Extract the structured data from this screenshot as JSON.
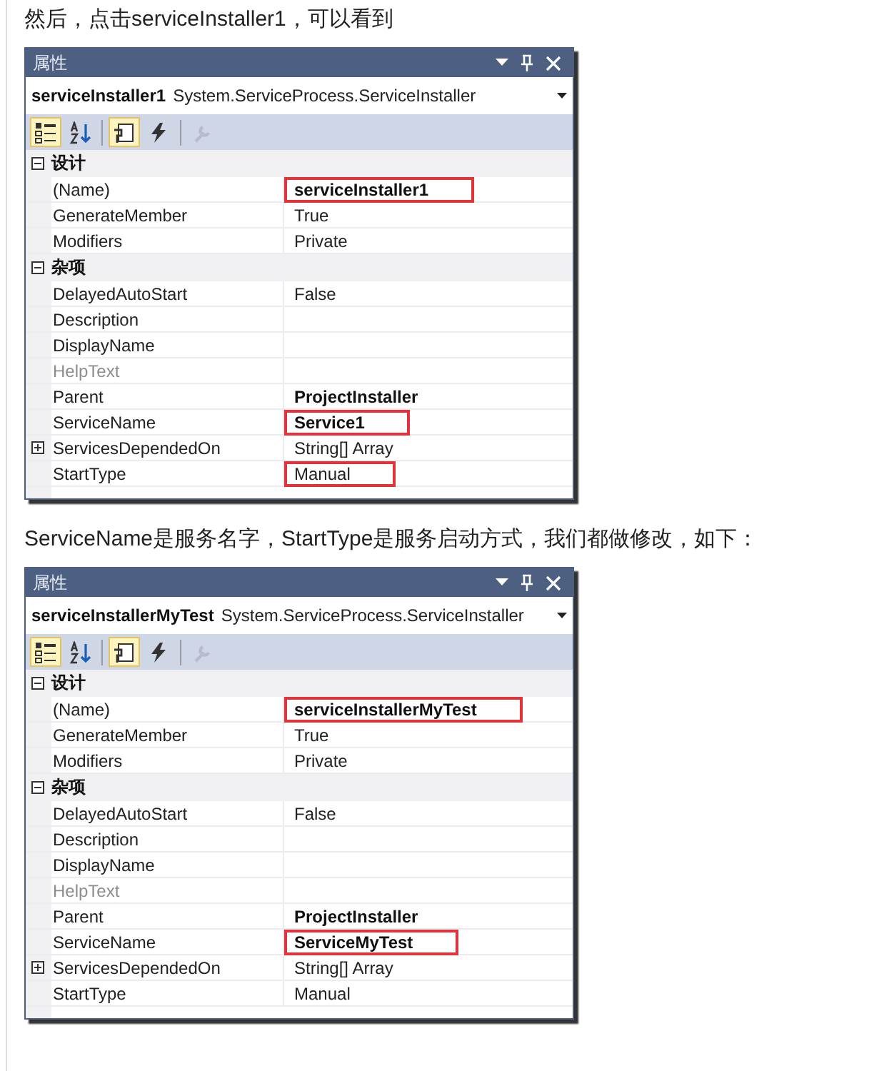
{
  "blocks": [
    {
      "kind": "paragraph",
      "text": "然后，点击serviceInstaller1，可以看到"
    },
    {
      "kind": "panel",
      "title": "属性",
      "object_name": "serviceInstaller1",
      "object_type": "System.ServiceProcess.ServiceInstaller",
      "toolbar": [
        {
          "kind": "categorized",
          "selected": true,
          "disabled": false
        },
        {
          "kind": "alphabetical",
          "selected": false,
          "disabled": false
        },
        {
          "kind": "properties",
          "selected": true,
          "disabled": false
        },
        {
          "kind": "events",
          "selected": false,
          "disabled": false
        },
        {
          "kind": "pages",
          "selected": false,
          "disabled": true
        }
      ],
      "categories": [
        {
          "label": "设计",
          "expanded": true,
          "properties": [
            {
              "name": "(Name)",
              "value": "serviceInstaller1",
              "bold": true,
              "highlighted": true,
              "disabled": false
            },
            {
              "name": "GenerateMember",
              "value": "True",
              "bold": false,
              "highlighted": false,
              "disabled": false
            },
            {
              "name": "Modifiers",
              "value": "Private",
              "bold": false,
              "highlighted": false,
              "disabled": false
            }
          ]
        },
        {
          "label": "杂项",
          "expanded": true,
          "properties": [
            {
              "name": "DelayedAutoStart",
              "value": "False",
              "bold": false,
              "highlighted": false,
              "disabled": false
            },
            {
              "name": "Description",
              "disabled": false
            },
            {
              "name": "DisplayName",
              "disabled": false
            },
            {
              "name": "HelpText",
              "disabled": true
            },
            {
              "name": "Parent",
              "value": "ProjectInstaller",
              "bold": true,
              "highlighted": false,
              "disabled": false
            },
            {
              "name": "ServiceName",
              "value": "Service1",
              "bold": true,
              "highlighted": true,
              "disabled": false
            },
            {
              "name": "ServicesDependedOn",
              "value": "String[] Array",
              "bold": false,
              "highlighted": false,
              "disabled": false,
              "expanded": false
            },
            {
              "name": "StartType",
              "value": "Manual",
              "bold": false,
              "highlighted": true,
              "disabled": false
            }
          ]
        }
      ]
    },
    {
      "kind": "paragraph",
      "text": "ServiceName是服务名字，StartType是服务启动方式，我们都做修改，如下："
    },
    {
      "kind": "panel",
      "title": "属性",
      "object_name": "serviceInstallerMyTest",
      "object_type": "System.ServiceProcess.ServiceInstaller",
      "toolbar": [
        {
          "kind": "categorized",
          "selected": true,
          "disabled": false
        },
        {
          "kind": "alphabetical",
          "selected": false,
          "disabled": false
        },
        {
          "kind": "properties",
          "selected": true,
          "disabled": false
        },
        {
          "kind": "events",
          "selected": false,
          "disabled": false
        },
        {
          "kind": "pages",
          "selected": false,
          "disabled": true
        }
      ],
      "categories": [
        {
          "label": "设计",
          "expanded": true,
          "properties": [
            {
              "name": "(Name)",
              "value": "serviceInstallerMyTest",
              "bold": true,
              "highlighted": true,
              "disabled": false
            },
            {
              "name": "GenerateMember",
              "value": "True",
              "bold": false,
              "highlighted": false,
              "disabled": false
            },
            {
              "name": "Modifiers",
              "value": "Private",
              "bold": false,
              "highlighted": false,
              "disabled": false
            }
          ]
        },
        {
          "label": "杂项",
          "expanded": true,
          "properties": [
            {
              "name": "DelayedAutoStart",
              "value": "False",
              "bold": false,
              "highlighted": false,
              "disabled": false
            },
            {
              "name": "Description",
              "disabled": false
            },
            {
              "name": "DisplayName",
              "disabled": false
            },
            {
              "name": "HelpText",
              "disabled": true
            },
            {
              "name": "Parent",
              "value": "ProjectInstaller",
              "bold": true,
              "highlighted": false,
              "disabled": false
            },
            {
              "name": "ServiceName",
              "value": "ServiceMyTest",
              "bold": true,
              "highlighted": true,
              "disabled": false
            },
            {
              "name": "ServicesDependedOn",
              "value": "String[] Array",
              "bold": false,
              "highlighted": false,
              "disabled": false,
              "expanded": false
            },
            {
              "name": "StartType",
              "value": "Manual",
              "bold": false,
              "highlighted": false,
              "disabled": false
            }
          ]
        }
      ]
    }
  ]
}
